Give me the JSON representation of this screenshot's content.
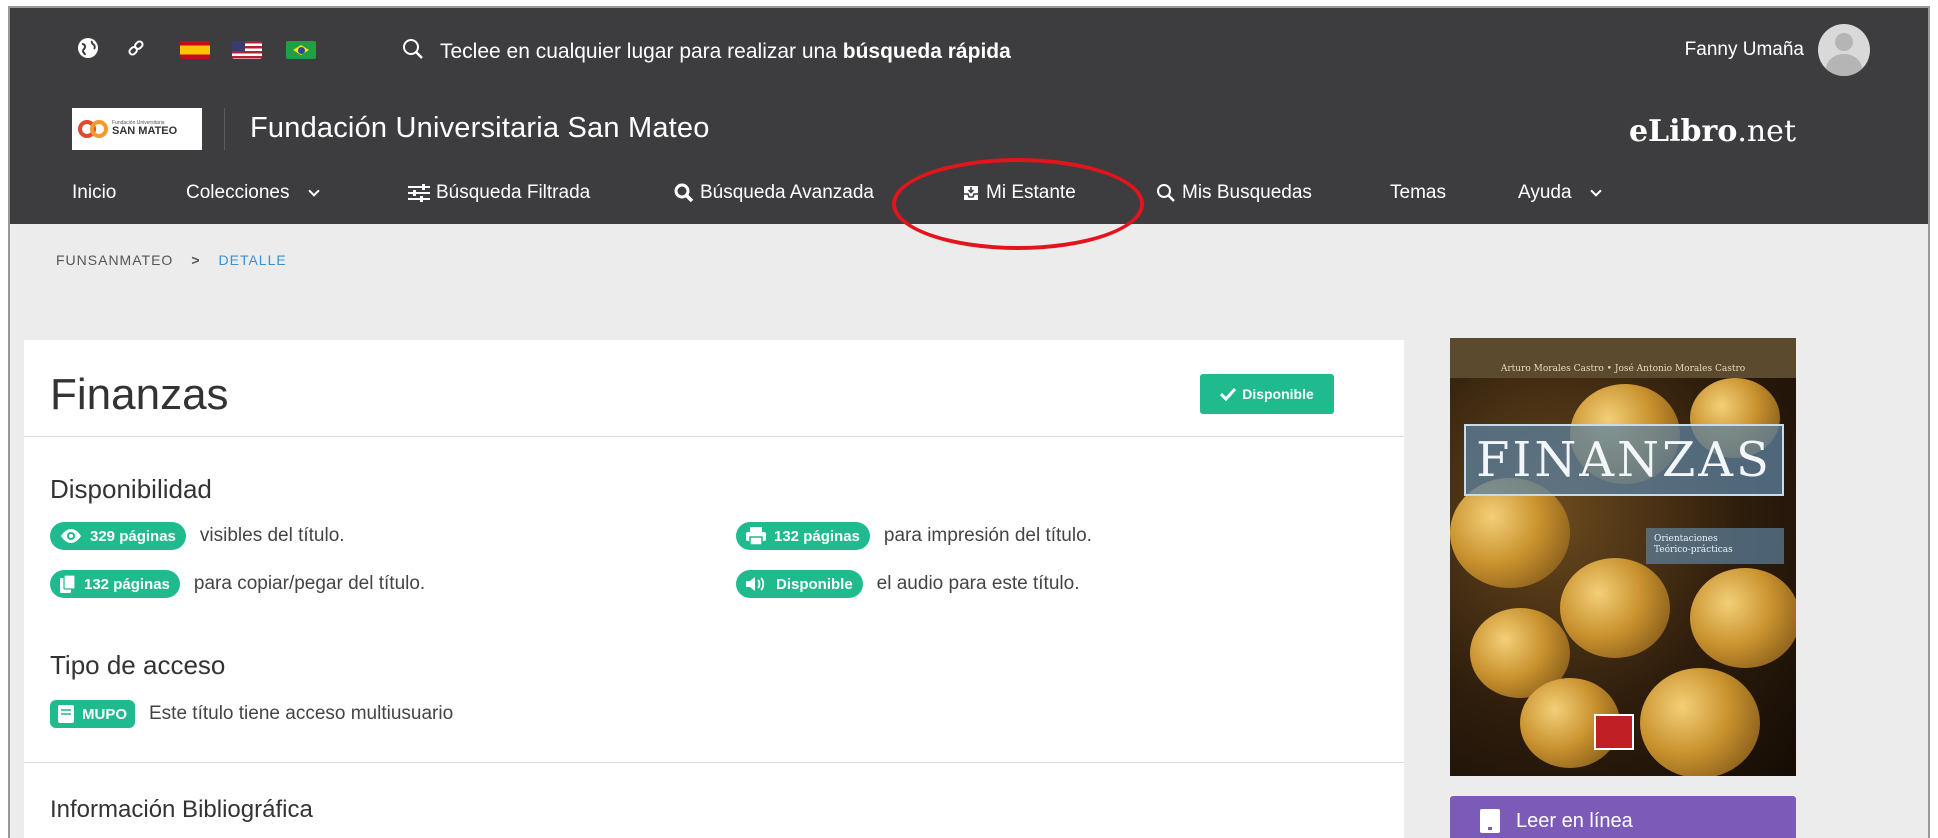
{
  "util_bar": {
    "search_prefix": "Teclee en cualquier lugar para realizar una ",
    "search_bold": "búsqueda rápida",
    "user_name": "Fanny Umaña",
    "icons": [
      "globe-icon",
      "link-icon",
      "flag-es-icon",
      "flag-us-icon",
      "flag-br-icon",
      "search-icon"
    ]
  },
  "brand": {
    "logo_small": "Fundación Universitaria",
    "logo_text": "SAN MATEO",
    "institution": "Fundación Universitaria San Mateo",
    "elibro_bold": "eLibro",
    "elibro_tld": ".net"
  },
  "nav": {
    "inicio": "Inicio",
    "colecciones": "Colecciones",
    "busqueda_filtrada": "Búsqueda Filtrada",
    "busqueda_avanzada": "Búsqueda Avanzada",
    "mi_estante": "Mi Estante",
    "mis_busquedas": "Mis Busquedas",
    "temas": "Temas",
    "ayuda": "Ayuda"
  },
  "breadcrumb": {
    "root": "FUNSANMATEO",
    "separator": ">",
    "current": "DETALLE"
  },
  "book": {
    "title": "Finanzas",
    "status_badge": "Disponible",
    "availability_title": "Disponibilidad",
    "visible_pages": "329 páginas",
    "visible_text": "visibles del título.",
    "print_pages": "132 páginas",
    "print_text": "para impresión del título.",
    "copy_pages": "132 páginas",
    "copy_text": "para copiar/pegar del título.",
    "audio_badge": "Disponible",
    "audio_text": "el audio para este título.",
    "access_title": "Tipo de acceso",
    "access_badge": "MUPO",
    "access_text": "Este título tiene acceso multiusuario",
    "biblio_title": "Información Bibliográfica"
  },
  "cover": {
    "authors": "Arturo Morales Castro • José Antonio Morales Castro",
    "title": "FINANZAS",
    "subtitle_1": "Orientaciones",
    "subtitle_2": "Teórico-prácticas"
  },
  "read_button": "Leer en línea",
  "colors": {
    "topbar": "#3d3d3f",
    "accent_green": "#1fbb8f",
    "read_purple": "#7b5ab8",
    "annotation_red": "#e3141b",
    "breadcrumb_active": "#3a8fd4"
  }
}
